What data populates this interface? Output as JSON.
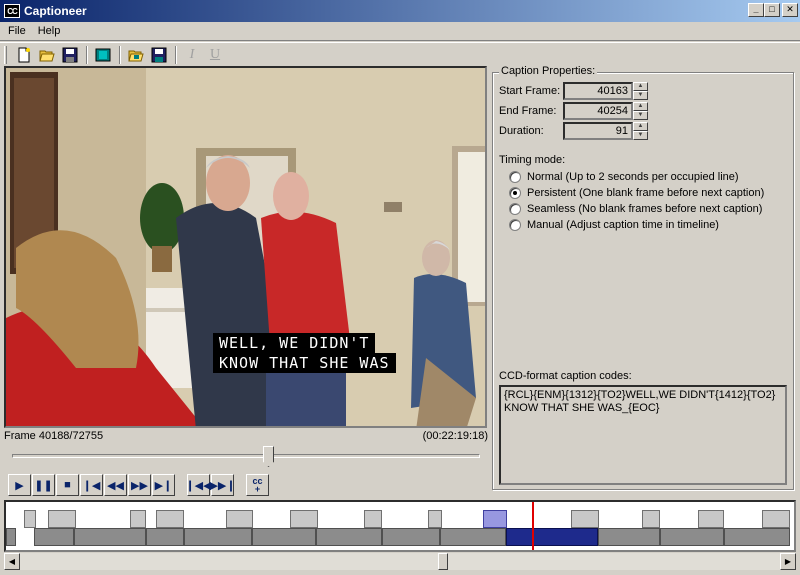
{
  "window": {
    "title": "Captioneer",
    "icon": "cc-icon",
    "icon_text": "CC"
  },
  "menu": {
    "items": [
      "File",
      "Help"
    ]
  },
  "toolbar": {
    "buttons": [
      "new-icon",
      "open-icon",
      "save-icon",
      "film-icon",
      "open-video-icon",
      "save-video-icon"
    ],
    "italic": "I",
    "underline": "U"
  },
  "video": {
    "caption_lines": [
      "WELL, WE DIDN'T",
      "KNOW THAT SHE WAS"
    ],
    "frame_text": "Frame 40188/72755",
    "timecode": "(00:22:19:18)",
    "position_fraction": 0.553
  },
  "transport": {
    "buttons": [
      "play",
      "pause",
      "stop",
      "prev-frame",
      "rewind",
      "fast-forward",
      "next-frame",
      "previous-caption",
      "next-caption",
      "insert-caption"
    ]
  },
  "caption_properties": {
    "title": "Caption Properties:",
    "start_frame_label": "Start Frame:",
    "start_frame": "40163",
    "end_frame_label": "End Frame:",
    "end_frame": "40254",
    "duration_label": "Duration:",
    "duration": "91",
    "timing_mode_label": "Timing mode:",
    "timing_modes": [
      {
        "label": "Normal (Up to 2 seconds per occupied line)",
        "selected": false
      },
      {
        "label": "Persistent (One blank frame before next caption)",
        "selected": true
      },
      {
        "label": "Seamless (No blank frames before next caption)",
        "selected": false
      },
      {
        "label": "Manual (Adjust caption time in timeline)",
        "selected": false
      }
    ],
    "ccd_label": "CCD-format caption codes:",
    "ccd_text": "{RCL}{ENM}{1312}{TO2}WELL,WE DIDN'T{1412}{TO2} KNOW THAT SHE WAS_{EOC}"
  },
  "colors": {
    "titlebar_start": "#0a246a",
    "titlebar_end": "#a6caf0",
    "selected_caption": "#1e2a8c",
    "playhead": "#e00000",
    "face": "#d4d0c8"
  }
}
